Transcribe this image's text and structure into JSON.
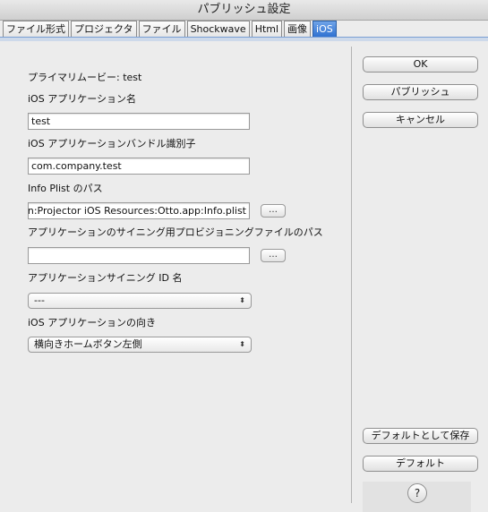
{
  "window": {
    "title": "パブリッシュ設定"
  },
  "tabs": [
    {
      "label": "ファイル形式"
    },
    {
      "label": "プロジェクタ"
    },
    {
      "label": "ファイル"
    },
    {
      "label": "Shockwave"
    },
    {
      "label": "Html"
    },
    {
      "label": "画像"
    },
    {
      "label": "iOS",
      "active": true
    }
  ],
  "form": {
    "primary_movie": "プライマリムービー: test",
    "app_name_label": "iOS アプリケーション名",
    "app_name_value": "test",
    "bundle_id_label": "iOS アプリケーションバンドル識別子",
    "bundle_id_value": "com.company.test",
    "plist_label": "Info Plist のパス",
    "plist_value": "guration:Projector iOS Resources:Otto.app:Info.plist",
    "plist_browse": "…",
    "provision_label": "アプリケーションのサイニング用プロビジョニングファイルのパス",
    "provision_value": "",
    "provision_browse": "…",
    "signing_label": "アプリケーションサイニング ID 名",
    "signing_value": "---",
    "orientation_label": "iOS アプリケーションの向き",
    "orientation_value": "横向きホームボタン左側"
  },
  "buttons": {
    "ok": "OK",
    "publish": "パブリッシュ",
    "cancel": "キャンセル",
    "save_default": "デフォルトとして保存",
    "default": "デフォルト",
    "help": "?"
  },
  "icons": {
    "select_arrows": "⬍"
  }
}
